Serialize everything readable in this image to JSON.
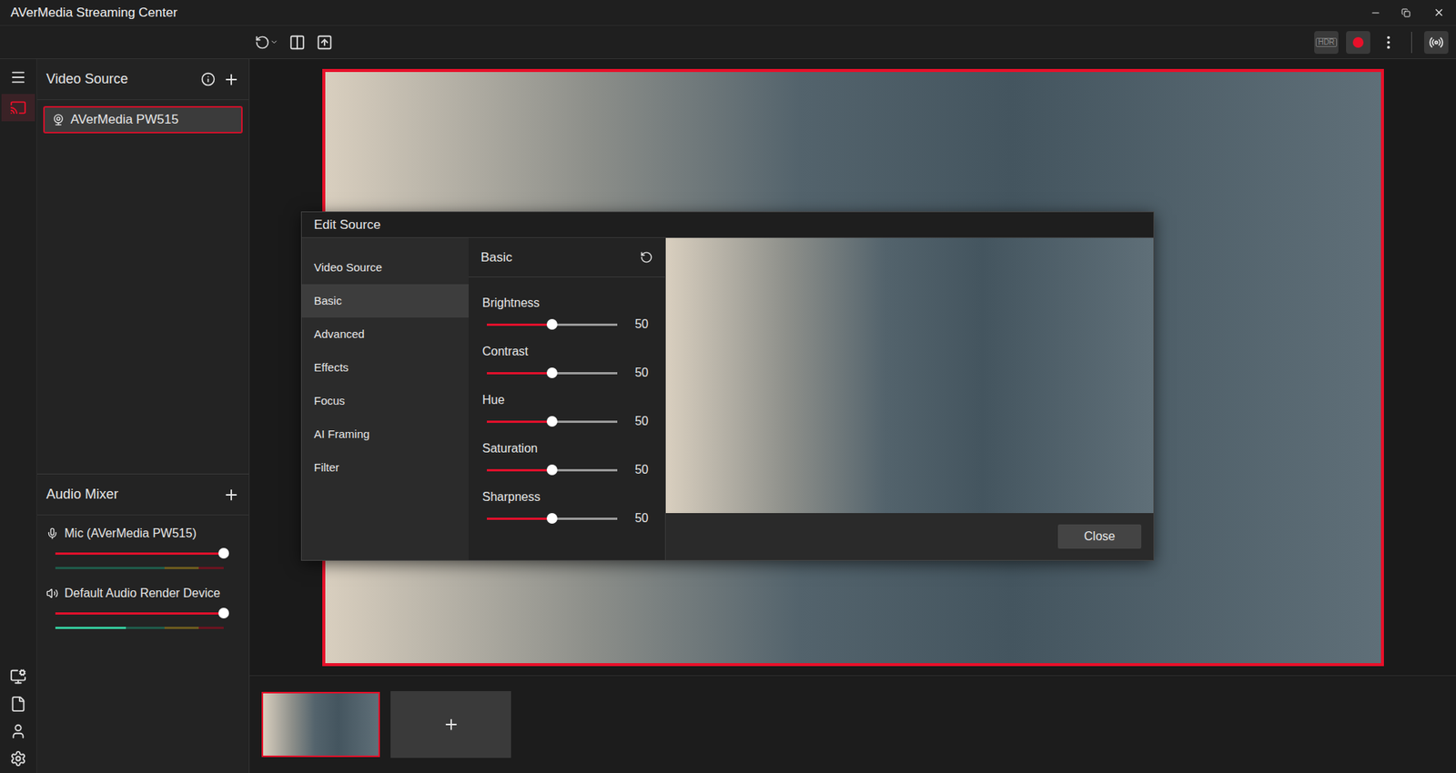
{
  "window": {
    "title": "AVerMedia Streaming Center"
  },
  "toolbar": {
    "hdr": "HDR",
    "recording": true
  },
  "rail": {
    "top": [
      {
        "selected": false
      },
      {
        "selected": true
      }
    ]
  },
  "video_source": {
    "title": "Video Source",
    "items": [
      {
        "label": "AVerMedia PW515",
        "selected": true
      }
    ]
  },
  "audio_mixer": {
    "title": "Audio Mixer",
    "channels": [
      {
        "name": "Mic (AVerMedia PW515)",
        "kind": "mic",
        "volume": 1,
        "level": 0
      },
      {
        "name": "Default Audio Render Device",
        "kind": "speaker",
        "volume": 1,
        "level": 0.42
      }
    ]
  },
  "edit_source": {
    "title": "Edit Source",
    "menu": [
      {
        "label": "Video Source",
        "selected": false
      },
      {
        "label": "Basic",
        "selected": true
      },
      {
        "label": "Advanced",
        "selected": false
      },
      {
        "label": "Effects",
        "selected": false
      },
      {
        "label": "Focus",
        "selected": false
      },
      {
        "label": "AI Framing",
        "selected": false
      },
      {
        "label": "Filter",
        "selected": false
      }
    ],
    "panel": {
      "title": "Basic",
      "sliders": [
        {
          "label": "Brightness",
          "level": 0.5,
          "value": "50"
        },
        {
          "label": "Contrast",
          "level": 0.5,
          "value": "50"
        },
        {
          "label": "Hue",
          "level": 0.5,
          "value": "50"
        },
        {
          "label": "Saturation",
          "level": 0.5,
          "value": "50"
        },
        {
          "label": "Sharpness",
          "level": 0.5,
          "value": "50"
        }
      ]
    },
    "close": "Close"
  },
  "scenes": {
    "items": [
      {
        "selected": true
      }
    ]
  }
}
